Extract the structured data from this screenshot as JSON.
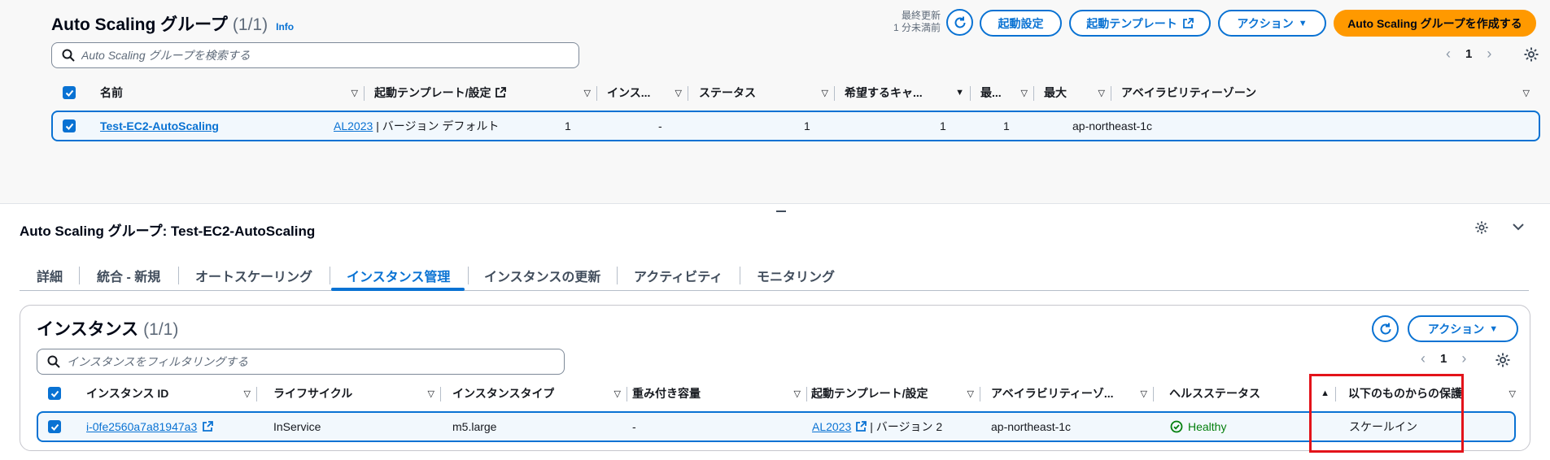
{
  "asg_list": {
    "title": "Auto Scaling グループ",
    "count": "(1/1)",
    "info": "Info",
    "last_updated_line1": "最終更新",
    "last_updated_line2": "1 分未満前",
    "btn_launch_config": "起動設定",
    "btn_launch_template": "起動テンプレート",
    "btn_actions": "アクション",
    "btn_create": "Auto Scaling グループを作成する",
    "search_placeholder": "Auto Scaling グループを検索する",
    "page": "1",
    "columns": [
      "名前",
      "起動テンプレート/設定",
      "インス...",
      "ステータス",
      "希望するキャ...",
      "最...",
      "最大",
      "アベイラビリティーゾーン"
    ],
    "rows": [
      {
        "name": "Test-EC2-AutoScaling",
        "template_link": "AL2023",
        "template_rest": "| バージョン デフォルト",
        "instances": "1",
        "status": "-",
        "desired": "1",
        "min": "1",
        "max": "1",
        "az": "ap-northeast-1c"
      }
    ]
  },
  "detail": {
    "title": "Auto Scaling グループ: Test-EC2-AutoScaling",
    "tabs": [
      {
        "label": "詳細"
      },
      {
        "label": "統合 - 新規"
      },
      {
        "label": "オートスケーリング"
      },
      {
        "label": "インスタンス管理"
      },
      {
        "label": "インスタンスの更新"
      },
      {
        "label": "アクティビティ"
      },
      {
        "label": "モニタリング"
      }
    ],
    "active_tab": "インスタンス管理"
  },
  "instances": {
    "title": "インスタンス",
    "count": "(1/1)",
    "btn_actions": "アクション",
    "search_placeholder": "インスタンスをフィルタリングする",
    "page": "1",
    "columns": [
      "インスタンス ID",
      "ライフサイクル",
      "インスタンスタイプ",
      "重み付き容量",
      "起動テンプレート/設定",
      "アベイラビリティーゾ...",
      "ヘルスステータス",
      "以下のものからの保護"
    ],
    "rows": [
      {
        "id": "i-0fe2560a7a81947a3",
        "lifecycle": "InService",
        "type": "m5.large",
        "weight": "-",
        "template_link": "AL2023",
        "template_rest": "| バージョン 2",
        "az": "ap-northeast-1c",
        "health": "Healthy",
        "protection": "スケールイン"
      }
    ]
  },
  "colors": {
    "accent": "#0972d3",
    "primary_button": "#ff9900",
    "highlight": "#e3131a",
    "healthy": "#037f0c"
  },
  "icons": [
    "refresh-icon",
    "external-link-icon",
    "caret-down-icon",
    "search-icon",
    "gear-icon",
    "checkbox-icon",
    "chevron-left-icon",
    "chevron-right-icon",
    "sort-icon",
    "check-circle-icon",
    "collapse-icon"
  ]
}
